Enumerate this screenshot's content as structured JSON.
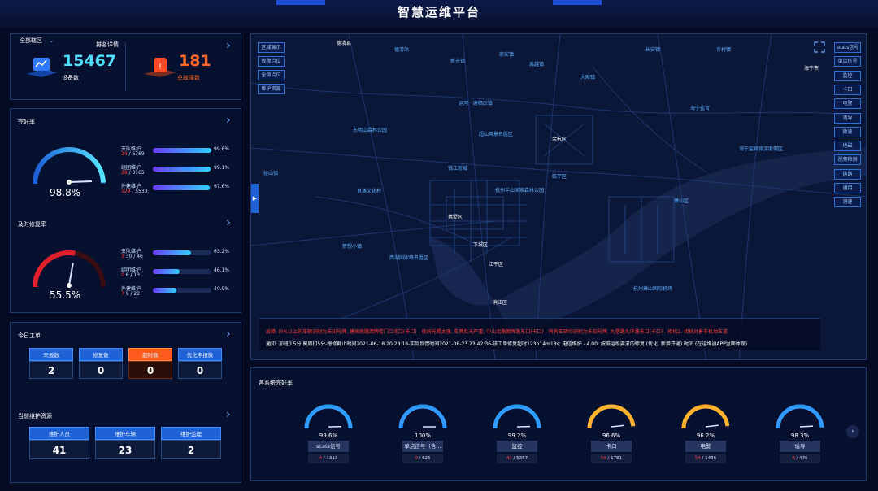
{
  "header": {
    "title": "智慧运维平台"
  },
  "summary": {
    "region_select": "全部辖区",
    "ranking_link": "排名详情",
    "device_count": "15467",
    "device_label": "设备数",
    "fault_count": "181",
    "fault_label": "总故障数"
  },
  "intact": {
    "title": "完好率",
    "gauge_value": "98.8%",
    "gauge_fraction": 0.988,
    "rows": [
      {
        "label": "支队维护",
        "fault": "24",
        "total": "/ 6769",
        "pct": "99.6%",
        "fraction": 0.996
      },
      {
        "label": "组团维护",
        "fault": "28",
        "total": "/ 3165",
        "pct": "99.1%",
        "fraction": 0.991
      },
      {
        "label": "外建维护",
        "fault": "129",
        "total": "/ 5533",
        "pct": "97.6%",
        "fraction": 0.976
      }
    ]
  },
  "repair": {
    "title": "及时修复率",
    "gauge_value": "55.5%",
    "gauge_fraction": 0.555,
    "rows": [
      {
        "label": "支队维护",
        "fault": "3",
        "total": "30 / 46",
        "pct": "65.2%",
        "fraction": 0.652
      },
      {
        "label": "组团维护",
        "fault": "0",
        "total": "6 / 13",
        "pct": "46.1%",
        "fraction": 0.461
      },
      {
        "label": "外建维护",
        "fault": "7",
        "total": "9 / 22",
        "pct": "40.9%",
        "fraction": 0.409
      }
    ]
  },
  "today_orders": {
    "title": "今日工单",
    "items": [
      {
        "label": "未报数",
        "value": "2"
      },
      {
        "label": "修复数",
        "value": "0"
      },
      {
        "label": "超时数",
        "value": "0"
      },
      {
        "label": "优化申报数",
        "value": "0"
      }
    ]
  },
  "resources": {
    "title": "当前维护资源",
    "items": [
      {
        "label": "维护人员",
        "value": "41"
      },
      {
        "label": "维护车辆",
        "value": "23"
      },
      {
        "label": "维护监理",
        "value": "2"
      }
    ]
  },
  "map": {
    "left_buttons": [
      "区域展示",
      "故障点位",
      "全部点位",
      "维护资源"
    ],
    "right_buttons": [
      "scats信号",
      "单点信号",
      "监控",
      "卡口",
      "电警",
      "诱导",
      "微波",
      "地磁",
      "视频检测",
      "链路",
      "通用",
      "测速"
    ],
    "places": [
      {
        "name": "德清县",
        "dim": false
      },
      {
        "name": "德清站",
        "dim": true
      },
      {
        "name": "新市镇",
        "dim": true
      },
      {
        "name": "崇安镇",
        "dim": true
      },
      {
        "name": "禹越镇",
        "dim": true
      },
      {
        "name": "大麻镇",
        "dim": true
      },
      {
        "name": "长安镇",
        "dim": true
      },
      {
        "name": "许村镇",
        "dim": true
      },
      {
        "name": "海宁市",
        "dim": false
      },
      {
        "name": "余杭区",
        "dim": false
      },
      {
        "name": "临平区",
        "dim": true
      },
      {
        "name": "拱墅区",
        "dim": false
      },
      {
        "name": "下城区",
        "dim": false
      },
      {
        "name": "江干区",
        "dim": false
      },
      {
        "name": "滨江区",
        "dim": false
      },
      {
        "name": "钱江新城",
        "dim": true
      },
      {
        "name": "杭州半山国家森林公园",
        "dim": true
      },
      {
        "name": "西湖国家级名胜区",
        "dim": true
      },
      {
        "name": "杭州萧山国际机场",
        "dim": true
      },
      {
        "name": "海宁盐官旅游度假区",
        "dim": true
      },
      {
        "name": "梦想小镇",
        "dim": true
      },
      {
        "name": "良渚文化村",
        "dim": true
      },
      {
        "name": "径山镇",
        "dim": true
      },
      {
        "name": "东明山森林公园",
        "dim": true
      },
      {
        "name": "超山风景名胜区",
        "dim": true
      },
      {
        "name": "运河 · 塘栖古镇",
        "dim": true
      },
      {
        "name": "海宁盐官",
        "dim": true
      },
      {
        "name": "萧山区",
        "dim": true
      }
    ],
    "alert_line": "故障: i0%以上的车辆识别为未知号牌, 建国南路西牌楼门口北口(卡口) - 夜间光照太强, 车牌反光严重, 中山北路朝晖路东口(卡口) - 所有车辆均识别为未知号牌, 九堡路九环路东口(卡口) - 相机2, 相机对着非机动车道",
    "notice_line": "通知: 加班0.5分,莫周扣5分-慢修截止时间2021-06-18 20:28:18-实际反馈时间2021-06-23 23:42:36-该工单修复超时123h14m18s; 电信维护 - 4.00; 按照运维要求的修复 (优化, 新增开通) 时间 (在运维通APP里面体现)"
  },
  "systems": {
    "title": "各系统完好率",
    "items": [
      {
        "name": "scats信号",
        "pct": "99.6%",
        "fraction": 0.996,
        "fault": "4",
        "total": "/ 1313",
        "color": "#2f9bff"
      },
      {
        "name": "单点信号（含...",
        "pct": "100%",
        "fraction": 1.0,
        "fault": "0",
        "total": "/ 625",
        "color": "#2f9bff"
      },
      {
        "name": "监控",
        "pct": "99.2%",
        "fraction": 0.992,
        "fault": "41",
        "total": "/ 5387",
        "color": "#2f9bff"
      },
      {
        "name": "卡口",
        "pct": "96.6%",
        "fraction": 0.966,
        "fault": "59",
        "total": "/ 1781",
        "color": "#ffb02e"
      },
      {
        "name": "电警",
        "pct": "96.2%",
        "fraction": 0.962,
        "fault": "54",
        "total": "/ 1436",
        "color": "#ffb02e"
      },
      {
        "name": "诱导",
        "pct": "98.3%",
        "fraction": 0.983,
        "fault": "8",
        "total": "/ 475",
        "color": "#2f9bff"
      }
    ]
  }
}
